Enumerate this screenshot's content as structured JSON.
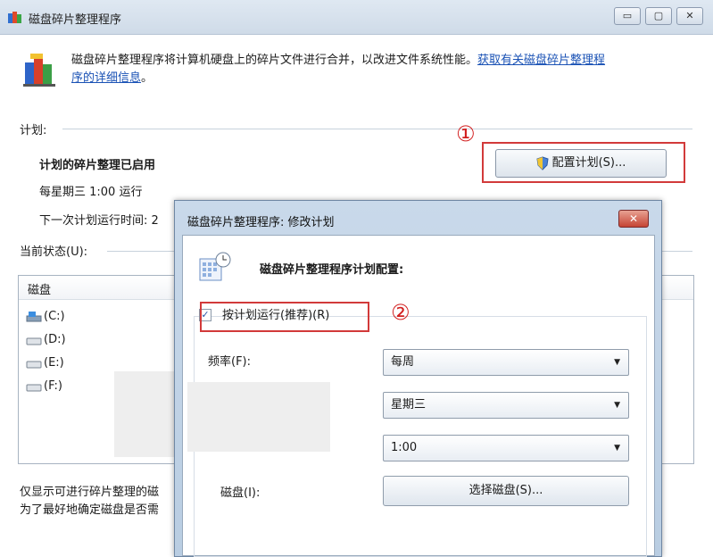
{
  "window": {
    "title": "磁盘碎片整理程序",
    "min_label": "▭",
    "max_label": "▢",
    "close_label": "✕"
  },
  "intro": {
    "text": "磁盘碎片整理程序将计算机硬盘上的碎片文件进行合并，以改进文件系统性能。",
    "link_line1": "获取有关磁盘碎片整理程",
    "link_line2": "序的详细信息",
    "end": "。"
  },
  "schedule": {
    "section_label": "计划:",
    "status": "计划的碎片整理已启用",
    "run_time": "每星期三  1:00 运行",
    "next_run": "下一次计划运行时间: 2",
    "config_button": "配置计划(S)..."
  },
  "annotations": {
    "step1": "①",
    "step2": "②"
  },
  "current": {
    "section_label": "当前状态(U):",
    "column_disk": "磁盘",
    "disks": [
      "(C:)",
      "(D:)",
      "(E:)",
      "(F:)"
    ],
    "footer_line1": "仅显示可进行碎片整理的磁",
    "footer_line2": "为了最好地确定磁盘是否需"
  },
  "dialog": {
    "title": "磁盘碎片整理程序: 修改计划",
    "close_label": "✕",
    "heading": "磁盘碎片整理程序计划配置:",
    "run_on_schedule": "按计划运行(推荐)(R)",
    "run_on_schedule_checked": true,
    "check_mark": "✓",
    "frequency_label": "频率(F):",
    "frequency_value": "每周",
    "day_value": "星期三",
    "time_value": "1:00",
    "disk_label": "磁盘(I):",
    "select_disk_button": "选择磁盘(S)..."
  },
  "colors": {
    "annotation_red": "#d21f1f",
    "link_blue": "#1a52b5",
    "title_bar": "#d6e1ed"
  }
}
